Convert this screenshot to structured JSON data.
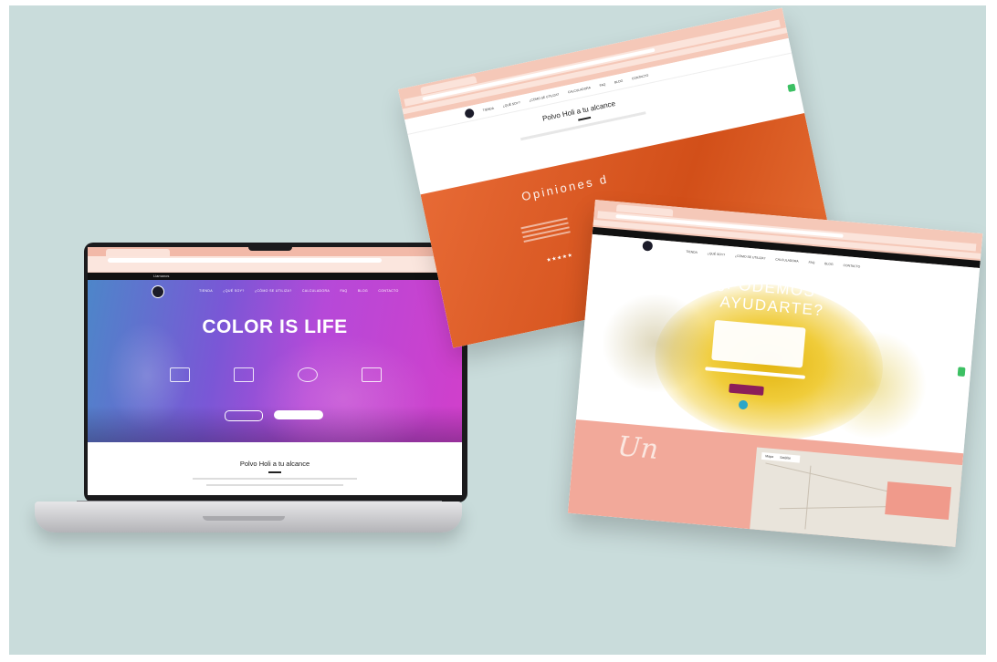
{
  "laptop": {
    "topbar": {
      "phone": "Llamanos",
      "cart": ""
    },
    "nav": [
      "TIENDA",
      "¿QUÉ SOY?",
      "¿CÓMO SE UTILIZA?",
      "CALCULADORA",
      "FAQ",
      "BLOG",
      "CONTACTO"
    ],
    "hero_title": "COLOR IS LIFE",
    "features": [
      "",
      "",
      "",
      ""
    ],
    "buttons": {
      "outline": "",
      "solid": ""
    },
    "section_title": "Polvo Holi a tu alcance"
  },
  "browser1": {
    "nav": [
      "TIENDA",
      "¿QUÉ SOY?",
      "¿CÓMO SE UTILIZA?",
      "CALCULADORA",
      "FAQ",
      "BLOG",
      "CONTACTO"
    ],
    "section_title": "Polvo Holi a tu alcance",
    "testimonials_title": "Opiniones d",
    "stars": "★★★★★"
  },
  "browser2": {
    "phone": "",
    "nav": [
      "TIENDA",
      "¿QUÉ SOY?",
      "¿CÓMO SE UTILIZA?",
      "CALCULADORA",
      "FAQ",
      "BLOG",
      "CONTACTO"
    ],
    "hero_line1": "¿PODEMOS",
    "hero_line2": "AYUDARTE?",
    "send_button": "",
    "script_text": "Un",
    "map_tabs": [
      "Mapa",
      "Satélite"
    ]
  },
  "colors": {
    "background": "#c9dcdb",
    "hero_gradient_start": "#4d86c9",
    "hero_gradient_end": "#d13fcb",
    "orange_section": "#d24f19",
    "pink_section": "#f2a99a",
    "browser_chrome": "#f5c8b8",
    "yellow_splash": "#f2c417"
  }
}
